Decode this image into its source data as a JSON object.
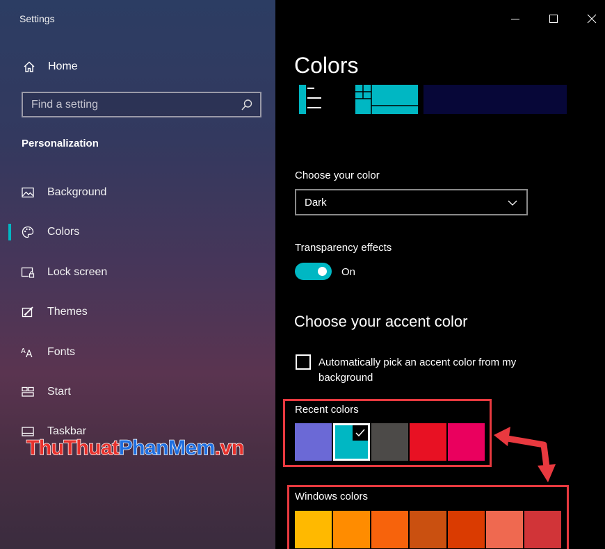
{
  "window": {
    "title": "Settings"
  },
  "sidebar": {
    "home_label": "Home",
    "search_placeholder": "Find a setting",
    "section_title": "Personalization",
    "items": [
      {
        "label": "Background",
        "icon": "picture-icon"
      },
      {
        "label": "Colors",
        "icon": "palette-icon",
        "selected": true
      },
      {
        "label": "Lock screen",
        "icon": "lock-screen-icon"
      },
      {
        "label": "Themes",
        "icon": "themes-icon"
      },
      {
        "label": "Fonts",
        "icon": "fonts-icon"
      },
      {
        "label": "Start",
        "icon": "start-icon"
      },
      {
        "label": "Taskbar",
        "icon": "taskbar-icon"
      }
    ]
  },
  "watermark": {
    "part1": "ThuThuat",
    "part2": "PhanMem",
    "part3": ".vn"
  },
  "main": {
    "title": "Colors",
    "choose_color_label": "Choose your color",
    "choose_color_value": "Dark",
    "transparency_label": "Transparency effects",
    "transparency_state": "On",
    "accent_heading": "Choose your accent color",
    "auto_pick_label": "Automatically pick an accent color from my background",
    "recent_colors_label": "Recent colors",
    "windows_colors_label": "Windows colors"
  },
  "colors": {
    "accent": "#00b7c3",
    "highlight": "#e8393f",
    "recent": [
      "#6b69d6",
      "#00b7c3",
      "#4c4a48",
      "#e81123",
      "#ea005e"
    ],
    "recent_selected_index": 1,
    "windows": [
      "#ffb900",
      "#ff8c00",
      "#f7630c",
      "#ca5010",
      "#da3b01",
      "#ef6950",
      "#d13438"
    ]
  }
}
